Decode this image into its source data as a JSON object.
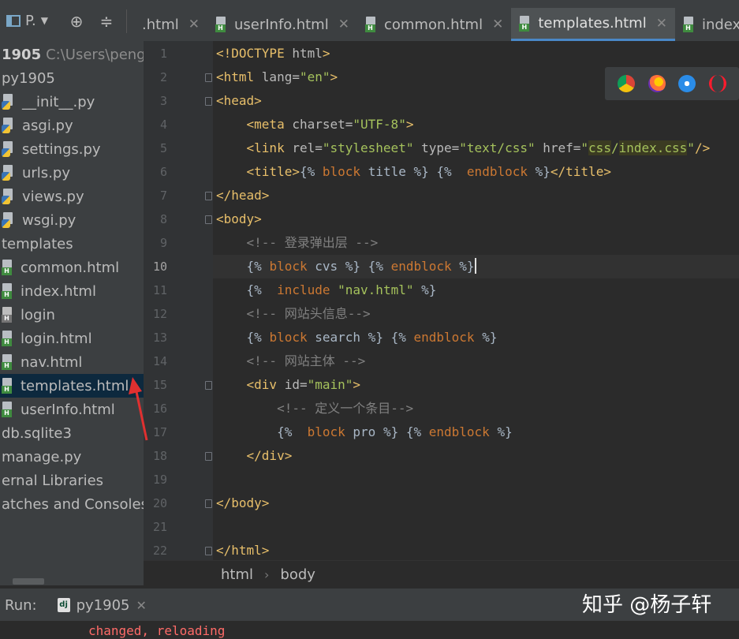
{
  "toolbar": {
    "project_button": "P."
  },
  "tabs": [
    {
      "label": ".html",
      "active": false,
      "icon": "none"
    },
    {
      "label": "userInfo.html",
      "active": false,
      "icon": "html"
    },
    {
      "label": "common.html",
      "active": false,
      "icon": "html"
    },
    {
      "label": "templates.html",
      "active": true,
      "icon": "html"
    },
    {
      "label": "index.",
      "active": false,
      "icon": "html"
    }
  ],
  "project": {
    "root_name": "1905",
    "root_path": "C:\\Users\\pengh",
    "items": [
      {
        "label": "py1905",
        "icon": "none"
      },
      {
        "label": "__init__.py",
        "icon": "py"
      },
      {
        "label": "asgi.py",
        "icon": "py"
      },
      {
        "label": "settings.py",
        "icon": "py"
      },
      {
        "label": "urls.py",
        "icon": "py"
      },
      {
        "label": "views.py",
        "icon": "py"
      },
      {
        "label": "wsgi.py",
        "icon": "py"
      },
      {
        "label": "templates",
        "icon": "none"
      },
      {
        "label": "common.html",
        "icon": "html"
      },
      {
        "label": "index.html",
        "icon": "html"
      },
      {
        "label": "login",
        "icon": "file"
      },
      {
        "label": "login.html",
        "icon": "html"
      },
      {
        "label": "nav.html",
        "icon": "html"
      },
      {
        "label": "templates.html",
        "icon": "html",
        "selected": true
      },
      {
        "label": "userInfo.html",
        "icon": "html"
      },
      {
        "label": "db.sqlite3",
        "icon": "none"
      },
      {
        "label": "manage.py",
        "icon": "none"
      },
      {
        "label": "ernal Libraries",
        "icon": "none"
      },
      {
        "label": "atches and Consoles",
        "icon": "none"
      }
    ]
  },
  "editor": {
    "current_line": 10,
    "lines": [
      "1",
      "2",
      "3",
      "4",
      "5",
      "6",
      "7",
      "8",
      "9",
      "10",
      "11",
      "12",
      "13",
      "14",
      "15",
      "16",
      "17",
      "18",
      "19",
      "20",
      "21",
      "22"
    ]
  },
  "breadcrumb": [
    "html",
    "body"
  ],
  "run": {
    "label": "Run:",
    "tab_label": "py1905",
    "console_text": "changed, reloading"
  },
  "watermark": "知乎 @杨子轩",
  "colors": {
    "accent": "#4a88c7",
    "selected_row": "#0d293e",
    "arrow": "#e03030"
  }
}
